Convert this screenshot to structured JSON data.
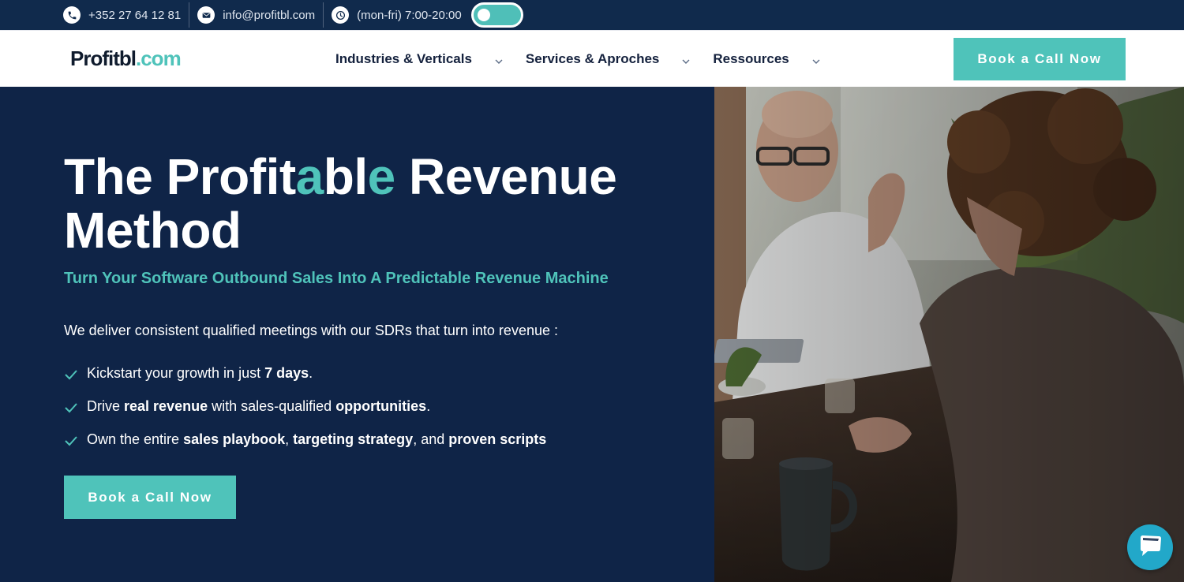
{
  "topbar": {
    "phone": "+352 27 64 12 81",
    "email": "info@profitbl.com",
    "hours": "(mon-fri) 7:00-20:00",
    "toggle_on": true
  },
  "header": {
    "logo_dark": "Profitbl",
    "logo_accent": ".com",
    "nav": [
      {
        "label": "Industries & Verticals"
      },
      {
        "label": "Services & Aproches"
      },
      {
        "label": "Ressources"
      }
    ],
    "cta_label": "Book a Call Now"
  },
  "hero": {
    "title_part1": "The Profit",
    "title_hl1": "a",
    "title_part2": "bl",
    "title_hl2": "e",
    "title_part3": " Revenue Method",
    "subtitle": "Turn Your Software Outbound Sales Into A Predictable Revenue Machine",
    "lead": "We deliver consistent qualified meetings with our SDRs that turn into revenue :",
    "bullet1": {
      "t1": "Kickstart your growth in just ",
      "b1": "7 days",
      "t2": "."
    },
    "bullet2": {
      "t1": "Drive ",
      "b1": "real revenue",
      "t2": " with sales-qualified ",
      "b2": "opportunities",
      "t3": "."
    },
    "bullet3": {
      "t1": "Own the entire ",
      "b1": "sales playbook",
      "t2": ", ",
      "b2": "targeting strategy",
      "t3": ", and ",
      "b3": "proven scripts"
    },
    "cta_label": "Book a Call Now"
  },
  "colors": {
    "navy": "#0f2447",
    "accent": "#4fc3ba",
    "chat": "#22a8c9"
  },
  "icons": {
    "phone": "phone-icon",
    "email": "envelope-icon",
    "hours": "clock-icon",
    "nav_chevron": "chevron-down-icon",
    "bullet": "check-icon",
    "chat": "chat-bubble-icon"
  }
}
